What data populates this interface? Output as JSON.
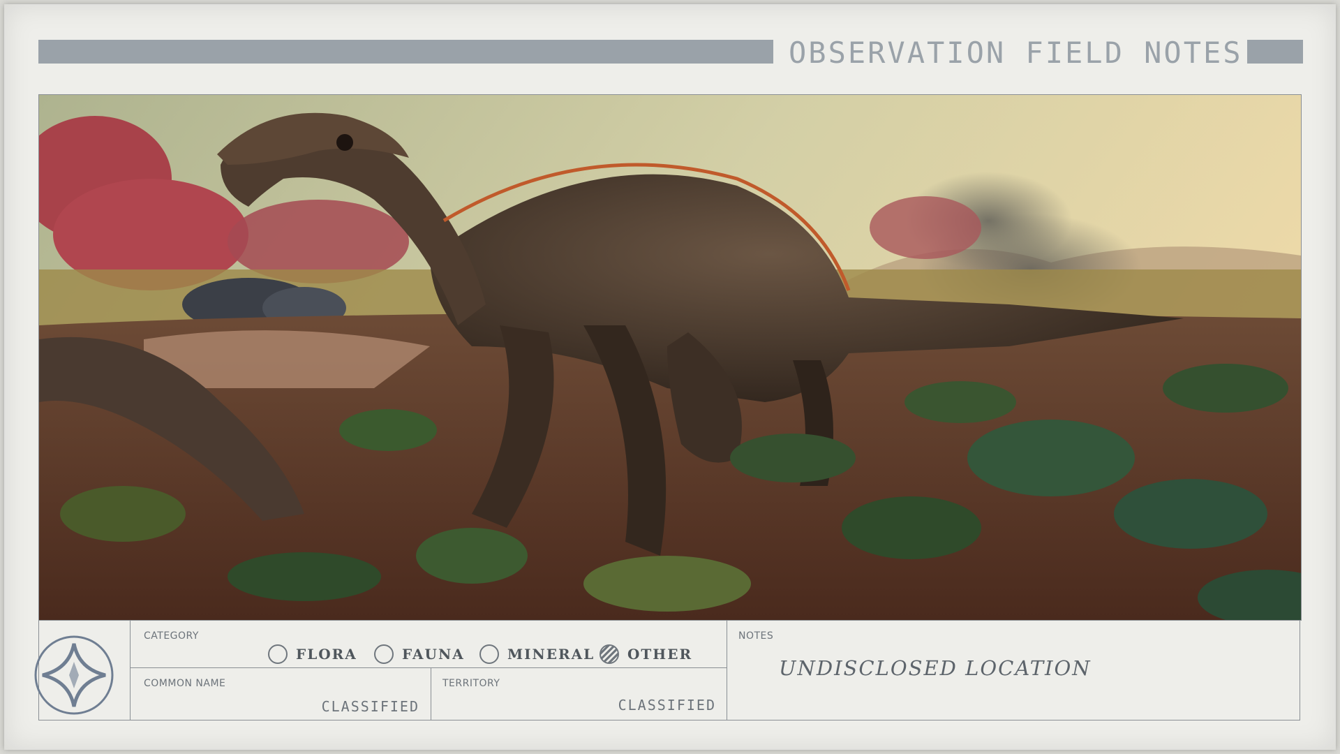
{
  "header": {
    "title": "OBSERVATION FIELD NOTES"
  },
  "category": {
    "label": "CATEGORY",
    "options": [
      {
        "label": "FLORA",
        "selected": false
      },
      {
        "label": "FAUNA",
        "selected": false
      },
      {
        "label": "MINERAL",
        "selected": false
      },
      {
        "label": "OTHER",
        "selected": true
      }
    ]
  },
  "common_name": {
    "label": "COMMON NAME",
    "value": "CLASSIFIED"
  },
  "territory": {
    "label": "TERRITORY",
    "value": "CLASSIFIED"
  },
  "notes": {
    "label": "NOTES",
    "value": "UNDISCLOSED LOCATION"
  },
  "icons": {
    "emblem": "four-point-star-emblem-icon"
  },
  "colors": {
    "card": "#eeeeea",
    "accent_bar": "#9aa2a9",
    "ink": "#4f565c"
  }
}
